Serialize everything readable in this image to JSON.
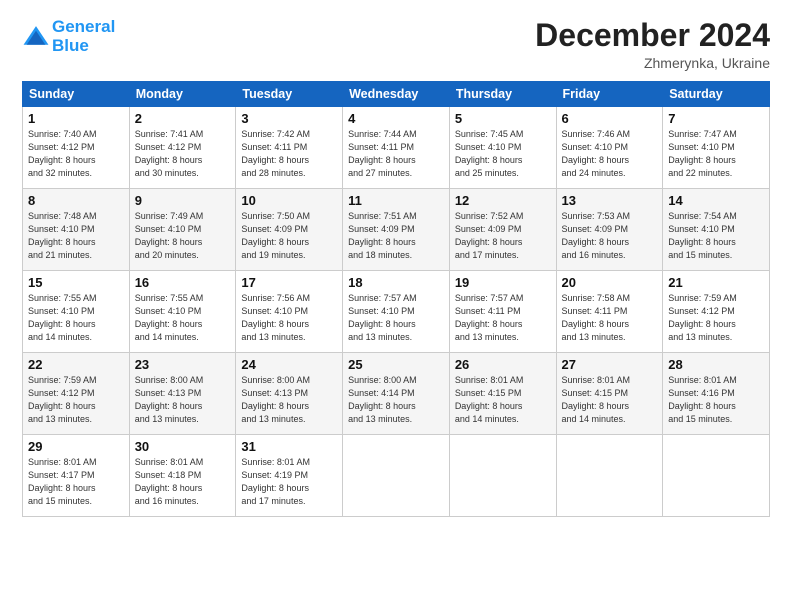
{
  "logo": {
    "line1": "General",
    "line2": "Blue"
  },
  "title": "December 2024",
  "subtitle": "Zhmerynka, Ukraine",
  "headers": [
    "Sunday",
    "Monday",
    "Tuesday",
    "Wednesday",
    "Thursday",
    "Friday",
    "Saturday"
  ],
  "weeks": [
    [
      {
        "day": "1",
        "lines": [
          "Sunrise: 7:40 AM",
          "Sunset: 4:12 PM",
          "Daylight: 8 hours",
          "and 32 minutes."
        ]
      },
      {
        "day": "2",
        "lines": [
          "Sunrise: 7:41 AM",
          "Sunset: 4:12 PM",
          "Daylight: 8 hours",
          "and 30 minutes."
        ]
      },
      {
        "day": "3",
        "lines": [
          "Sunrise: 7:42 AM",
          "Sunset: 4:11 PM",
          "Daylight: 8 hours",
          "and 28 minutes."
        ]
      },
      {
        "day": "4",
        "lines": [
          "Sunrise: 7:44 AM",
          "Sunset: 4:11 PM",
          "Daylight: 8 hours",
          "and 27 minutes."
        ]
      },
      {
        "day": "5",
        "lines": [
          "Sunrise: 7:45 AM",
          "Sunset: 4:10 PM",
          "Daylight: 8 hours",
          "and 25 minutes."
        ]
      },
      {
        "day": "6",
        "lines": [
          "Sunrise: 7:46 AM",
          "Sunset: 4:10 PM",
          "Daylight: 8 hours",
          "and 24 minutes."
        ]
      },
      {
        "day": "7",
        "lines": [
          "Sunrise: 7:47 AM",
          "Sunset: 4:10 PM",
          "Daylight: 8 hours",
          "and 22 minutes."
        ]
      }
    ],
    [
      {
        "day": "8",
        "lines": [
          "Sunrise: 7:48 AM",
          "Sunset: 4:10 PM",
          "Daylight: 8 hours",
          "and 21 minutes."
        ]
      },
      {
        "day": "9",
        "lines": [
          "Sunrise: 7:49 AM",
          "Sunset: 4:10 PM",
          "Daylight: 8 hours",
          "and 20 minutes."
        ]
      },
      {
        "day": "10",
        "lines": [
          "Sunrise: 7:50 AM",
          "Sunset: 4:09 PM",
          "Daylight: 8 hours",
          "and 19 minutes."
        ]
      },
      {
        "day": "11",
        "lines": [
          "Sunrise: 7:51 AM",
          "Sunset: 4:09 PM",
          "Daylight: 8 hours",
          "and 18 minutes."
        ]
      },
      {
        "day": "12",
        "lines": [
          "Sunrise: 7:52 AM",
          "Sunset: 4:09 PM",
          "Daylight: 8 hours",
          "and 17 minutes."
        ]
      },
      {
        "day": "13",
        "lines": [
          "Sunrise: 7:53 AM",
          "Sunset: 4:09 PM",
          "Daylight: 8 hours",
          "and 16 minutes."
        ]
      },
      {
        "day": "14",
        "lines": [
          "Sunrise: 7:54 AM",
          "Sunset: 4:10 PM",
          "Daylight: 8 hours",
          "and 15 minutes."
        ]
      }
    ],
    [
      {
        "day": "15",
        "lines": [
          "Sunrise: 7:55 AM",
          "Sunset: 4:10 PM",
          "Daylight: 8 hours",
          "and 14 minutes."
        ]
      },
      {
        "day": "16",
        "lines": [
          "Sunrise: 7:55 AM",
          "Sunset: 4:10 PM",
          "Daylight: 8 hours",
          "and 14 minutes."
        ]
      },
      {
        "day": "17",
        "lines": [
          "Sunrise: 7:56 AM",
          "Sunset: 4:10 PM",
          "Daylight: 8 hours",
          "and 13 minutes."
        ]
      },
      {
        "day": "18",
        "lines": [
          "Sunrise: 7:57 AM",
          "Sunset: 4:10 PM",
          "Daylight: 8 hours",
          "and 13 minutes."
        ]
      },
      {
        "day": "19",
        "lines": [
          "Sunrise: 7:57 AM",
          "Sunset: 4:11 PM",
          "Daylight: 8 hours",
          "and 13 minutes."
        ]
      },
      {
        "day": "20",
        "lines": [
          "Sunrise: 7:58 AM",
          "Sunset: 4:11 PM",
          "Daylight: 8 hours",
          "and 13 minutes."
        ]
      },
      {
        "day": "21",
        "lines": [
          "Sunrise: 7:59 AM",
          "Sunset: 4:12 PM",
          "Daylight: 8 hours",
          "and 13 minutes."
        ]
      }
    ],
    [
      {
        "day": "22",
        "lines": [
          "Sunrise: 7:59 AM",
          "Sunset: 4:12 PM",
          "Daylight: 8 hours",
          "and 13 minutes."
        ]
      },
      {
        "day": "23",
        "lines": [
          "Sunrise: 8:00 AM",
          "Sunset: 4:13 PM",
          "Daylight: 8 hours",
          "and 13 minutes."
        ]
      },
      {
        "day": "24",
        "lines": [
          "Sunrise: 8:00 AM",
          "Sunset: 4:13 PM",
          "Daylight: 8 hours",
          "and 13 minutes."
        ]
      },
      {
        "day": "25",
        "lines": [
          "Sunrise: 8:00 AM",
          "Sunset: 4:14 PM",
          "Daylight: 8 hours",
          "and 13 minutes."
        ]
      },
      {
        "day": "26",
        "lines": [
          "Sunrise: 8:01 AM",
          "Sunset: 4:15 PM",
          "Daylight: 8 hours",
          "and 14 minutes."
        ]
      },
      {
        "day": "27",
        "lines": [
          "Sunrise: 8:01 AM",
          "Sunset: 4:15 PM",
          "Daylight: 8 hours",
          "and 14 minutes."
        ]
      },
      {
        "day": "28",
        "lines": [
          "Sunrise: 8:01 AM",
          "Sunset: 4:16 PM",
          "Daylight: 8 hours",
          "and 15 minutes."
        ]
      }
    ],
    [
      {
        "day": "29",
        "lines": [
          "Sunrise: 8:01 AM",
          "Sunset: 4:17 PM",
          "Daylight: 8 hours",
          "and 15 minutes."
        ]
      },
      {
        "day": "30",
        "lines": [
          "Sunrise: 8:01 AM",
          "Sunset: 4:18 PM",
          "Daylight: 8 hours",
          "and 16 minutes."
        ]
      },
      {
        "day": "31",
        "lines": [
          "Sunrise: 8:01 AM",
          "Sunset: 4:19 PM",
          "Daylight: 8 hours",
          "and 17 minutes."
        ]
      },
      null,
      null,
      null,
      null
    ]
  ]
}
